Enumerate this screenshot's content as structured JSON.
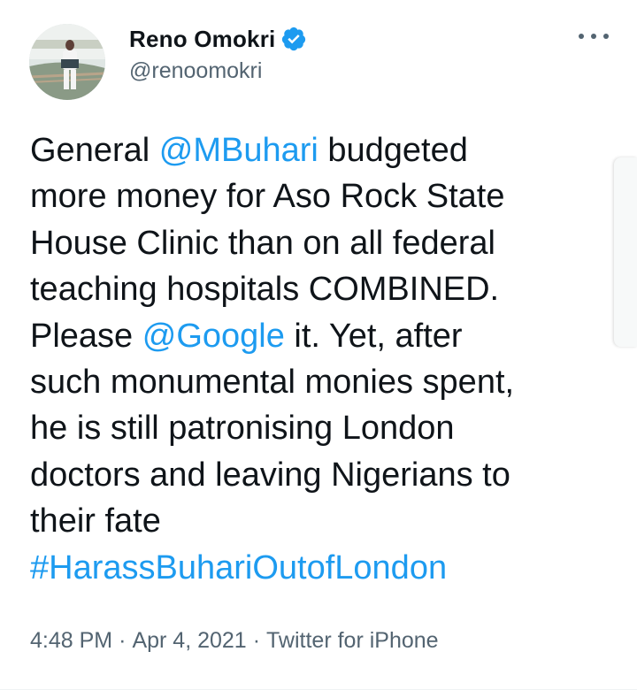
{
  "author": {
    "display_name": "Reno Omokri",
    "handle": "@renoomokri",
    "verified": true
  },
  "tweet": {
    "lines": [
      [
        {
          "text": "General ",
          "type": "text"
        },
        {
          "text": "@MBuhari",
          "type": "link"
        },
        {
          "text": " budgeted",
          "type": "text"
        }
      ],
      [
        {
          "text": "more money for Aso Rock State",
          "type": "text"
        }
      ],
      [
        {
          "text": "House Clinic than on all federal",
          "type": "text"
        }
      ],
      [
        {
          "text": "teaching hospitals COMBINED.",
          "type": "text"
        }
      ],
      [
        {
          "text": "Please ",
          "type": "text"
        },
        {
          "text": "@Google",
          "type": "link"
        },
        {
          "text": " it. Yet, after",
          "type": "text"
        }
      ],
      [
        {
          "text": "such monumental monies spent,",
          "type": "text"
        }
      ],
      [
        {
          "text": "he is still patronising London",
          "type": "text"
        }
      ],
      [
        {
          "text": "doctors and leaving Nigerians to",
          "type": "text"
        }
      ],
      [
        {
          "text": "their fate",
          "type": "text"
        }
      ],
      [
        {
          "text": "#HarassBuhariOutofLondon",
          "type": "link"
        }
      ]
    ]
  },
  "meta": {
    "time": "4:48 PM",
    "separator": "·",
    "date": "Apr 4, 2021",
    "source": "Twitter for iPhone"
  },
  "colors": {
    "link": "#1d9bf0",
    "verified": "#1d9bf0",
    "text": "#0f1419",
    "muted": "#536471"
  },
  "icons": {
    "verified": "verified-badge-icon",
    "more": "more-options-icon"
  }
}
